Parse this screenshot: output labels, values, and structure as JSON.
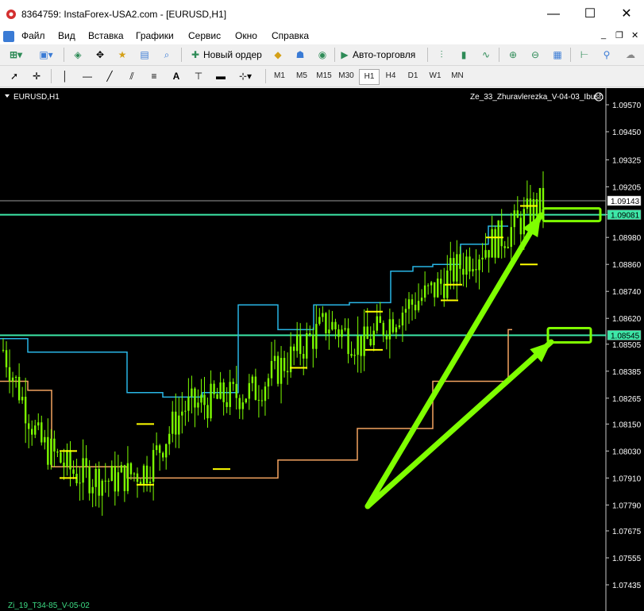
{
  "window": {
    "title": "8364759: InstaForex-USA2.com - [EURUSD,H1]",
    "minimize": "—",
    "maximize": "☐",
    "close": "✕"
  },
  "menu": [
    "Файл",
    "Вид",
    "Вставка",
    "Графики",
    "Сервис",
    "Окно",
    "Справка"
  ],
  "toolbar": {
    "new_order": "Новый ордер",
    "auto_trading": "Авто-торговля"
  },
  "timeframes": [
    "M1",
    "M5",
    "M15",
    "M30",
    "H1",
    "H4",
    "D1",
    "W1",
    "MN"
  ],
  "active_timeframe": "H1",
  "chart": {
    "symbol_label": "EURUSD,H1",
    "indicator_top": "Ze_33_Zhuravlerezka_V-04-03_Ibush",
    "indicator_bottom": "Zi_19_T34-85_V-05-02",
    "price_labels": [
      "1.09570",
      "1.09450",
      "1.09325",
      "1.09205",
      "1.09081",
      "1.08980",
      "1.08860",
      "1.08740",
      "1.08620",
      "1.08505",
      "1.08385",
      "1.08265",
      "1.08150",
      "1.08030",
      "1.07910",
      "1.07790",
      "1.07675",
      "1.07555",
      "1.07435"
    ],
    "current_price": "1.09143",
    "level_high": "1.09081",
    "level_low": "1.08545",
    "colors": {
      "background": "#000000",
      "candles": "#7cfc00",
      "channel_upper": "#29b6e6",
      "channel_lower": "#f4a460",
      "levels": "#3de8a8",
      "markers": "#ffff00",
      "arrows": "#7fff00"
    }
  },
  "chart_data": {
    "type": "line",
    "title": "EURUSD,H1",
    "ylim": [
      1.0737,
      1.0963
    ],
    "horizontal_levels": [
      1.09081,
      1.08545
    ],
    "current_price": 1.09143,
    "series": [
      {
        "name": "Ze_33_Zhuravlerezka_V-04-03_Ibush",
        "values": [
          1.0848,
          1.0807,
          1.0793,
          1.079,
          1.0795,
          1.0822,
          1.0826,
          1.083,
          1.0845,
          1.086,
          1.085,
          1.0865,
          1.0875,
          1.089,
          1.09,
          1.0914
        ]
      }
    ]
  }
}
